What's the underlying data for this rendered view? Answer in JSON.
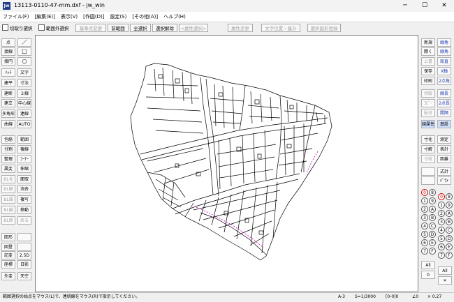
{
  "window": {
    "title": "13113-0110-47-mm.dxf - jw_win",
    "app_icon": "Jw",
    "controls": {
      "minimize": "─",
      "maximize": "☐",
      "close": "✕"
    }
  },
  "menu": [
    "ファイル(F)",
    "[編集(E)]",
    "表示(V)",
    "[作図(D)]",
    "設定(S)",
    "[その他(A)]",
    "ヘルプ(H)"
  ],
  "toolbar": {
    "chk_cut": "切取り選択",
    "chk_outside": "範囲外選択",
    "base_point": "基準点変更",
    "prev_range": "前範囲",
    "select_all": "全選択",
    "deselect": "選択解除",
    "attr_select": "<属性選択>",
    "attr_change": "属性変更",
    "text_pos": "文字位置・集計",
    "sel_register": "選択図形登録"
  },
  "left_tools": {
    "r0": [
      "点",
      "／"
    ],
    "r1": [
      "接線",
      "□"
    ],
    "r2": [
      "接円",
      "○"
    ],
    "r3": [
      "ﾊｯﾁ",
      "文字"
    ],
    "r4": [
      "建平",
      "寸法"
    ],
    "r5": [
      "建断",
      "２線"
    ],
    "r6": [
      "建立",
      "中心線"
    ],
    "r7": [
      "多角形",
      "連線"
    ],
    "r8": [
      "曲線",
      "AUTO"
    ],
    "r9": [
      "包絡",
      "範囲"
    ],
    "r10": [
      "分割",
      "複線"
    ],
    "r11": [
      "整理",
      "ｺｰﾅｰ"
    ],
    "r12": [
      "属変",
      "伸縮"
    ],
    "r13": [
      "BL化",
      "面取"
    ],
    "r14": [
      "BL解",
      "消去"
    ],
    "r15": [
      "BL属",
      "複写"
    ],
    "r16": [
      "BL編",
      "移動"
    ],
    "r17": [
      "BL終",
      "戻る"
    ],
    "r18": [
      "図形",
      ""
    ],
    "r19": [
      "図登",
      ""
    ],
    "r20": [
      "記変",
      "2.5D"
    ],
    "r21": [
      "座標",
      "日影"
    ],
    "r22": [
      "外変",
      "天空"
    ]
  },
  "right_tools": {
    "r0": [
      "新規",
      "線角"
    ],
    "r1": [
      "開く",
      "線角"
    ],
    "r2": [
      "上書",
      "鉛直"
    ],
    "r3": [
      "保存",
      "X軸"
    ],
    "r4": [
      "印刷",
      "2点角"
    ],
    "r5": [
      "切取",
      "線長"
    ],
    "r6": [
      "ｺﾋﾟｰ",
      "2点長"
    ],
    "r7": [
      "貼付",
      "間隔"
    ],
    "r8": [
      "線属性",
      "基設"
    ],
    "r9": [
      "寸化",
      "測定"
    ],
    "r10": [
      "寸解",
      "表計"
    ],
    "r11": [
      "寸収",
      "距離"
    ],
    "r12": [
      "",
      "式計"
    ],
    "r13": [
      "",
      "ﾊﾟﾗﾒ"
    ]
  },
  "layers": {
    "group_col": [
      "0",
      "1",
      "2",
      "3",
      "4",
      "5",
      "6",
      "7"
    ],
    "group_col2": [
      "8",
      "9",
      "A",
      "B",
      "C",
      "D",
      "E",
      "F"
    ],
    "layer_col": [
      "0",
      "1",
      "2",
      "3",
      "4",
      "5",
      "6",
      "7"
    ],
    "layer_col2": [
      "8",
      "9",
      "A",
      "B",
      "C",
      "D",
      "E",
      "F"
    ],
    "all_left": "All",
    "zero_left": "0",
    "all_right": "All",
    "x_right": "✕"
  },
  "status": {
    "message": "範囲選択の始点をマウス(L)で、連続線をマウス(R)で指示してください。",
    "paper": "A-3",
    "scale": "S=1/3000",
    "layer": "[0-0]0",
    "angle": "∠0",
    "zoom": "× 0.27"
  }
}
